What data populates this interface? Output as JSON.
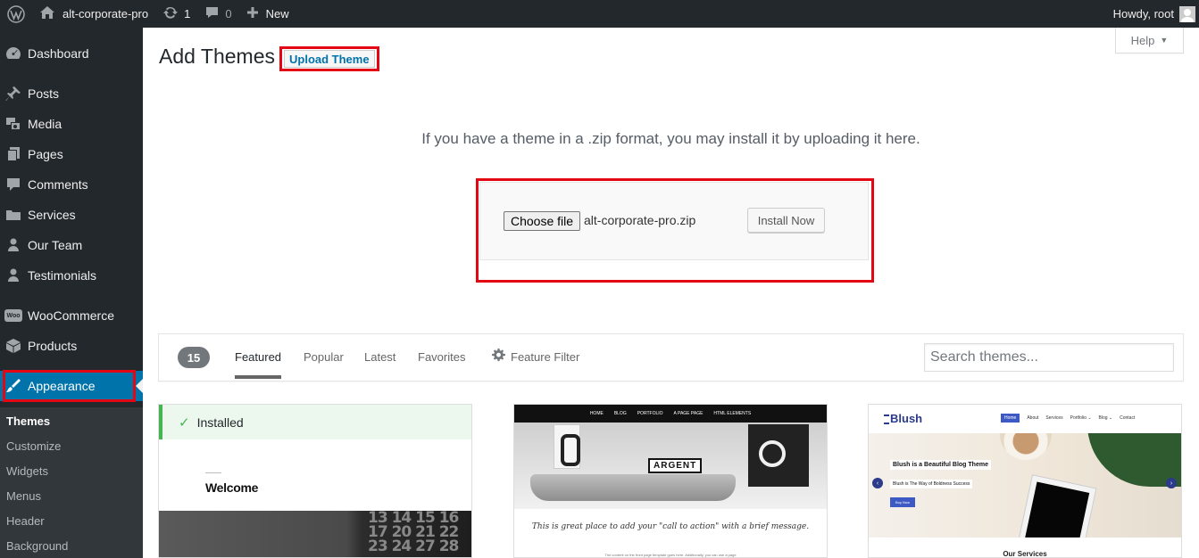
{
  "adminbar": {
    "site_name": "alt-corporate-pro",
    "updates_count": "1",
    "comments_count": "0",
    "new_label": "New",
    "greeting": "Howdy, root"
  },
  "sidebar": {
    "items": [
      {
        "label": "Dashboard",
        "icon": "dashboard-icon"
      },
      {
        "label": "Posts",
        "icon": "pin-icon"
      },
      {
        "label": "Media",
        "icon": "media-icon"
      },
      {
        "label": "Pages",
        "icon": "pages-icon"
      },
      {
        "label": "Comments",
        "icon": "comment-icon"
      },
      {
        "label": "Services",
        "icon": "folder-icon"
      },
      {
        "label": "Our Team",
        "icon": "person-icon"
      },
      {
        "label": "Testimonials",
        "icon": "person-icon"
      },
      {
        "label": "WooCommerce",
        "icon": "woo-icon"
      },
      {
        "label": "Products",
        "icon": "box-icon"
      },
      {
        "label": "Appearance",
        "icon": "paintbrush-icon",
        "active": true
      }
    ],
    "submenu": [
      "Themes",
      "Customize",
      "Widgets",
      "Menus",
      "Header",
      "Background"
    ]
  },
  "header": {
    "title": "Add Themes",
    "upload_button": "Upload Theme",
    "help_label": "Help"
  },
  "upload": {
    "description": "If you have a theme in a .zip format, you may install it by uploading it here.",
    "choose_file_label": "Choose file",
    "file_name": "alt-corporate-pro.zip",
    "install_button": "Install Now"
  },
  "filter": {
    "count": "15",
    "tabs": [
      "Featured",
      "Popular",
      "Latest",
      "Favorites"
    ],
    "current_tab": "Featured",
    "feature_filter_label": "Feature Filter",
    "search_placeholder": "Search themes..."
  },
  "themes": {
    "installed": {
      "status": "Installed",
      "welcome": "Welcome",
      "calendar_digits": "13 14 15 16 17 20 21 22 23 24 27 28"
    },
    "argent": {
      "nav": [
        "HOME",
        "BLOG",
        "PORTFOLIO",
        "A PAGE PAGE",
        "HTML ELEMENTS"
      ],
      "logo": "ARGENT",
      "cta": "This is great place to add your \"call to action\" with a brief message.",
      "small": "The content on the front page template goes here. Additionally, you can use a page"
    },
    "blush": {
      "logo": "Blush",
      "nav": [
        "Home",
        "About",
        "Services",
        "Portfolio ⌄",
        "Blog ⌄",
        "Contact"
      ],
      "caption": "Blush is a Beautiful Blog Theme",
      "subcaption": "Blush is The Way of Boldness Success",
      "button": "Buy Now",
      "services": "Our Services"
    }
  },
  "colors": {
    "admin_bg": "#23282d",
    "accent": "#0073aa",
    "highlight": "#e30613",
    "installed_green": "#46b450"
  }
}
